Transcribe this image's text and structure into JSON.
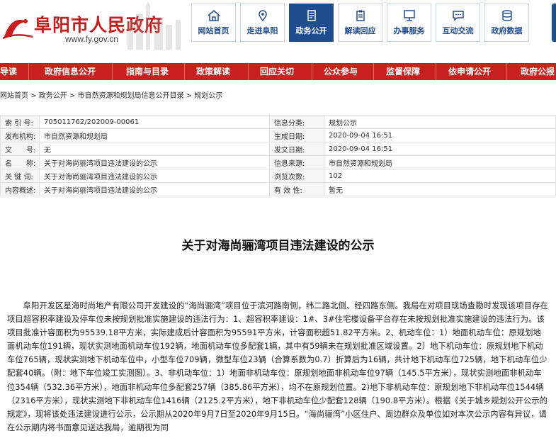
{
  "site": {
    "title": "阜阳市人民政府",
    "url": "www.fy.gov.cn"
  },
  "top_nav": [
    {
      "label": "网站首页",
      "icon": "home-icon",
      "active": false
    },
    {
      "label": "走进阜阳",
      "icon": "location-icon",
      "active": false
    },
    {
      "label": "政务公开",
      "icon": "document-icon",
      "active": true
    },
    {
      "label": "解读回应",
      "icon": "clipboard-icon",
      "active": false
    },
    {
      "label": "办事服务",
      "icon": "monitor-icon",
      "active": false
    },
    {
      "label": "互动交流",
      "icon": "chat-icon",
      "active": false
    },
    {
      "label": "政府数据",
      "icon": "database-icon",
      "active": false
    }
  ],
  "main_nav": [
    "导读",
    "政府信息公开",
    "指南与目录",
    "政策解读",
    "回应关切",
    "公众参与",
    "监督保障",
    "依申请公开",
    "政府公报"
  ],
  "breadcrumb": "网站首页 > 政务公开 > 市自然资源和规划局信息公开目录 > 规划公示",
  "meta": {
    "index_label": "索 引 号:",
    "index_value": "705011762/202009-00061",
    "category_label": "信息分类:",
    "category_value": "规划公示",
    "publisher_label": "发布机构:",
    "publisher_value": "市自然资源和规划局",
    "created_label": "生成日期:",
    "created_value": "2020-09-04 16:51",
    "docno_label": "文　　号:",
    "docno_value": "无",
    "issued_label": "发文日期:",
    "issued_value": "2020-09-04 16:51",
    "name_label": "名　　称:",
    "name_value": "关于对海尚骊湾项目违法建设的公示",
    "source_label": "信息来源:",
    "source_value": "市自然资源和规划局",
    "keywords_label": "关 键 词:",
    "keywords_value": "关于对海尚骊湾项目违法建设的公示",
    "views_label": "浏览次数:",
    "views_value": "102",
    "summary_label": "内容概述:",
    "summary_value": "关于对海尚骊湾项目违法建设的公示",
    "validity_label": "有 效 性:",
    "validity_value": "暂无"
  },
  "article": {
    "title": "关于对海尚骊湾项目违法建设的公示",
    "body": "阜阳开发区星海时尚地产有限公司开发建设的“海尚骊湾”项目位于滨河路南侧，纬二路北侧、经四路东侧。我局在对项目现场查勘时发现该项目存在项目超容积率建设及停车位未按规划批准实施建设的违法行为：1、超容积率建设：1#、3#住宅楼设备平台存在未按规划批准实施建设的违法行为。该项目批准计容面积为95539.18平方米，实际建成后计容面积为95591平方米，计容面积超51.82平方米。2、机动车位：1）地面机动车位：原规划地面机动车位191辆，现状实测地面机动车位192辆，地面机动车位多配套1辆，其中有59辆未在规划批准区域设置。2）地下机动车位：原规划地下机动车位765辆，现状实测地下机动车位中，小型车位709辆，微型车位23辆（合算系数为0.7）折算后为16辆，共计地下机动车位725辆，地下机动车位少配套40辆。（附：地下车位竣工实测图）。3、非机动车位：1）地面非机动车位：原规划地面非机动车位97辆（145.5平方米），现状实测地面非机动车位354辆（532.36平方米），地面非机动车位多配套257辆（385.86平方米），均不在原规划位置。2)地下非机动车位：原规划地下非机动车位1544辆（2316平方米），现状实测地下非机动车位1416辆（2125.2平方米），地下非机动车位少配套128辆（190.8平方米）。根据《关于城乡规划公开公示的规定》，现将该处违法建设进行公示，公示期从2020年9月7日至2020年9月15日。“海尚骊湾”小区住户、周边群众及单位如对本次公示内容有异议，请在公示期内将书面意见送达我局，逾期视为同"
  },
  "colors": {
    "brand_red": "#c8201e",
    "nav_blue": "#1e4c8f"
  }
}
